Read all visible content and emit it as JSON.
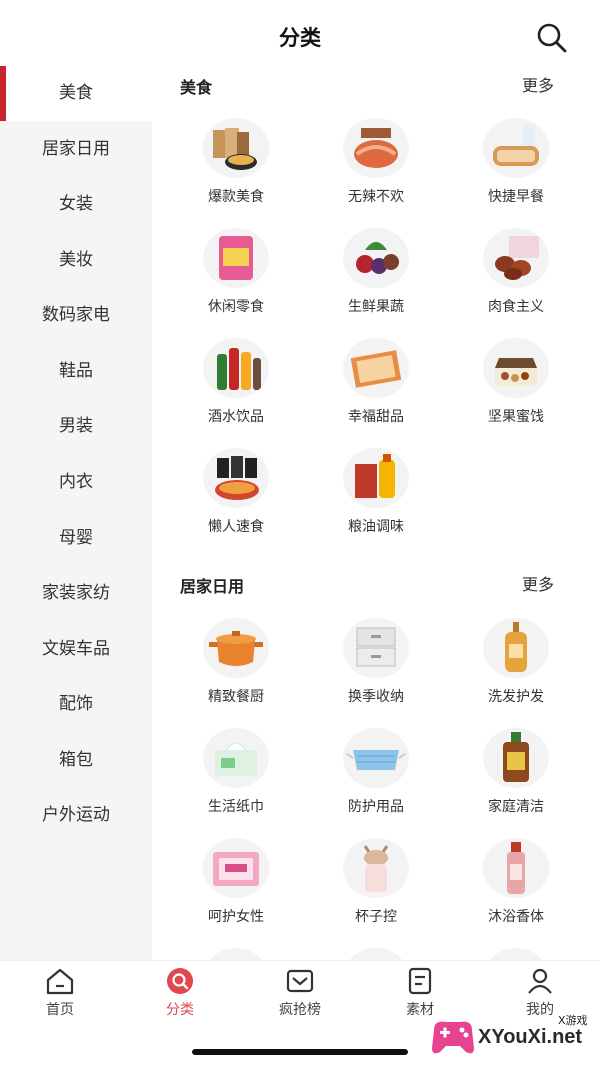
{
  "header": {
    "title": "分类",
    "icon": "search-icon"
  },
  "sidebar": {
    "items": [
      {
        "label": "美食",
        "active": true
      },
      {
        "label": "居家日用"
      },
      {
        "label": "女装"
      },
      {
        "label": "美妆"
      },
      {
        "label": "数码家电"
      },
      {
        "label": "鞋品"
      },
      {
        "label": "男装"
      },
      {
        "label": "内衣"
      },
      {
        "label": "母婴"
      },
      {
        "label": "家装家纺"
      },
      {
        "label": "文娱车品"
      },
      {
        "label": "配饰"
      },
      {
        "label": "箱包"
      },
      {
        "label": "户外运动"
      }
    ]
  },
  "sections": [
    {
      "title": "美食",
      "more": "更多",
      "items": [
        {
          "label": "爆款美食",
          "icon": "snack-bowl-icon"
        },
        {
          "label": "无辣不欢",
          "icon": "spicy-meat-icon"
        },
        {
          "label": "快捷早餐",
          "icon": "bread-milk-icon"
        },
        {
          "label": "休闲零食",
          "icon": "snack-bag-icon"
        },
        {
          "label": "生鲜果蔬",
          "icon": "fruit-icon"
        },
        {
          "label": "肉食主义",
          "icon": "meat-icon"
        },
        {
          "label": "酒水饮品",
          "icon": "bottles-icon"
        },
        {
          "label": "幸福甜品",
          "icon": "dessert-box-icon"
        },
        {
          "label": "坚果蜜饯",
          "icon": "nuts-box-icon"
        },
        {
          "label": "懒人速食",
          "icon": "instant-noodle-icon"
        },
        {
          "label": "粮油调味",
          "icon": "oil-rice-icon"
        }
      ]
    },
    {
      "title": "居家日用",
      "more": "更多",
      "items": [
        {
          "label": "精致餐厨",
          "icon": "pot-icon"
        },
        {
          "label": "换季收纳",
          "icon": "storage-box-icon"
        },
        {
          "label": "洗发护发",
          "icon": "shampoo-icon"
        },
        {
          "label": "生活纸巾",
          "icon": "tissue-icon"
        },
        {
          "label": "防护用品",
          "icon": "mask-icon"
        },
        {
          "label": "家庭清洁",
          "icon": "disinfectant-icon"
        },
        {
          "label": "呵护女性",
          "icon": "pad-icon"
        },
        {
          "label": "杯子控",
          "icon": "cup-icon"
        },
        {
          "label": "沐浴香体",
          "icon": "body-wash-icon"
        }
      ]
    }
  ],
  "tabbar": {
    "items": [
      {
        "label": "首页",
        "icon": "home-icon"
      },
      {
        "label": "分类",
        "icon": "category-search-icon",
        "active": true
      },
      {
        "label": "疯抢榜",
        "icon": "ranking-icon"
      },
      {
        "label": "素材",
        "icon": "material-icon"
      },
      {
        "label": "我的",
        "icon": "profile-icon"
      }
    ]
  },
  "watermark": {
    "text": "XYouXi.net",
    "small": "X游戏"
  },
  "colors": {
    "accent": "#c9252d",
    "active_tab": "#e0474f",
    "sidebar_bg": "#f5f5f5"
  }
}
